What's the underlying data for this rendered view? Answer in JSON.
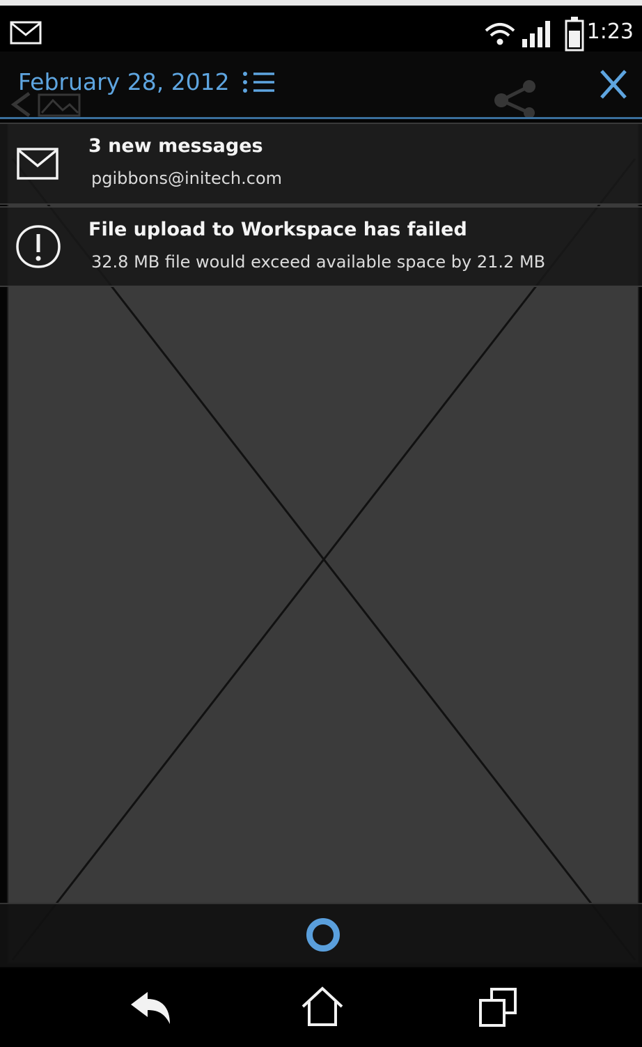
{
  "status_bar": {
    "time": "1:23",
    "icons": [
      "envelope-icon",
      "wifi-icon",
      "signal-icon",
      "battery-icon"
    ]
  },
  "header": {
    "date": "February 28, 2012",
    "icons": [
      "list-icon",
      "close-icon"
    ]
  },
  "notifications": [
    {
      "icon": "envelope-icon",
      "title": "3 new messages",
      "text": "pgibbons@initech.com"
    },
    {
      "icon": "alert-icon",
      "title": "File upload to Workspace has failed",
      "text": "32.8 MB file would exceed available space by 21.2 MB"
    }
  ],
  "nav_bar": {
    "icons": [
      "back-icon",
      "home-icon",
      "recent-apps-icon"
    ]
  },
  "colors": {
    "accent": "#5ea5e0",
    "background": "#3b3b3b"
  }
}
